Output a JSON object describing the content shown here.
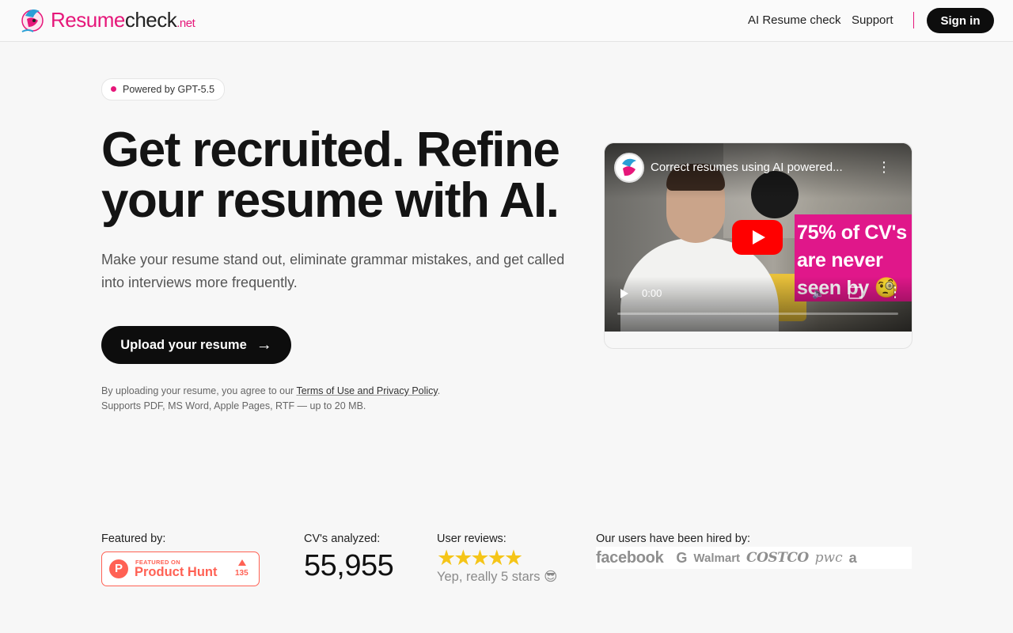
{
  "brand": {
    "name_part1": "Resume",
    "name_part2": "check",
    "name_tld": ".net",
    "pink": "#e6177a"
  },
  "nav": {
    "ai_resume_check": "AI Resume check",
    "support": "Support",
    "sign_in": "Sign in"
  },
  "hero": {
    "badge": "Powered by GPT-5.5",
    "headline_line1": "Get recruited. Refine",
    "headline_line2": "your resume with AI.",
    "subtitle": "Make your resume stand out, eliminate grammar mistakes, and get called into interviews more frequently.",
    "upload_label": "Upload your resume",
    "upload_arrow": "→",
    "terms_prefix": "By uploading your resume, you agree to our ",
    "terms_link": "Terms of Use and Privacy Policy",
    "terms_suffix": ".",
    "supports": "Supports PDF, MS Word, Apple Pages, RTF — up to 20 MB."
  },
  "video": {
    "title": "Correct resumes using AI powered...",
    "overlay_text": "75% of CV's are never seen by 🧐",
    "time": "0:00",
    "icons": [
      "play-icon",
      "youtube-play-icon",
      "more-vert-icon",
      "volume-icon",
      "fullscreen-icon"
    ]
  },
  "stats": {
    "featured_label": "Featured by:",
    "ph_small": "FEATURED ON",
    "ph_big": "Product Hunt",
    "ph_count": "135",
    "cv_label": "CV's analyzed:",
    "cv_count": "55,955",
    "reviews_label": "User reviews:",
    "stars": "★★★★★",
    "rating": 5,
    "reviews_text": "Yep, really 5 stars 😎",
    "hired_label": "Our users have been hired by:",
    "companies": [
      "facebook",
      "",
      "G",
      "Walmart",
      "COSTCO",
      "pwc",
      "a"
    ]
  }
}
